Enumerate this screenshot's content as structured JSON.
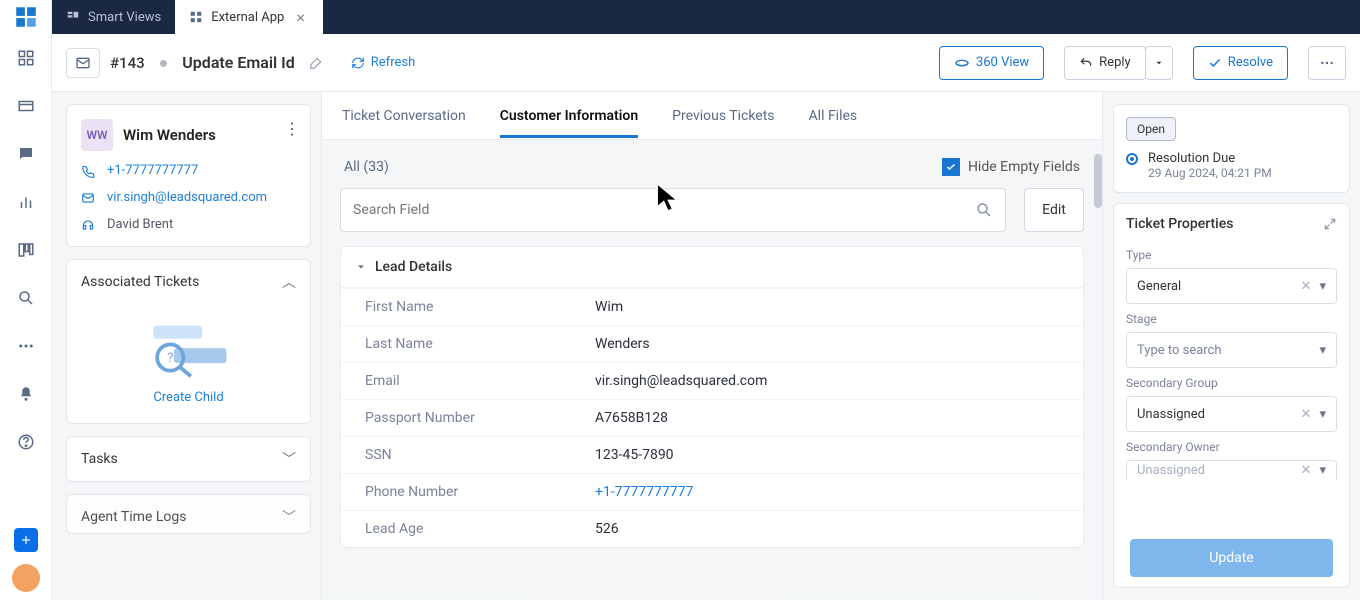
{
  "tabs": {
    "smart_views": "Smart Views",
    "external_app": "External App"
  },
  "ticket": {
    "id": "#143",
    "title": "Update Email Id",
    "refresh": "Refresh"
  },
  "actions": {
    "view360": "360 View",
    "reply": "Reply",
    "resolve": "Resolve"
  },
  "contact": {
    "initials": "WW",
    "name": "Wim Wenders",
    "phone": "+1-7777777777",
    "email": "vir.singh@leadsquared.com",
    "agent": "David Brent"
  },
  "assoc": {
    "title": "Associated Tickets",
    "create_child": "Create Child"
  },
  "left_collapsibles": {
    "tasks": "Tasks",
    "agent_logs": "Agent Time Logs"
  },
  "ptabs": {
    "conversation": "Ticket Conversation",
    "customer_info": "Customer Information",
    "previous": "Previous Tickets",
    "files": "All Files"
  },
  "filters": {
    "all": "All (33)",
    "hide_empty": "Hide Empty Fields",
    "search_placeholder": "Search Field",
    "edit": "Edit"
  },
  "section_title": "Lead Details",
  "lead": {
    "first_name_label": "First Name",
    "first_name": "Wim",
    "last_name_label": "Last Name",
    "last_name": "Wenders",
    "email_label": "Email",
    "email": "vir.singh@leadsquared.com",
    "passport_label": "Passport Number",
    "passport": "A7658B128",
    "ssn_label": "SSN",
    "ssn": "123-45-7890",
    "phone_label": "Phone Number",
    "phone": "+1-7777777777",
    "age_label": "Lead Age",
    "age": "526"
  },
  "right": {
    "open": "Open",
    "res_due": "Resolution Due",
    "res_time": "29 Aug 2024, 04:21 PM",
    "props_title": "Ticket Properties",
    "type_label": "Type",
    "type_value": "General",
    "stage_label": "Stage",
    "stage_placeholder": "Type to search",
    "sec_group_label": "Secondary Group",
    "sec_group_value": "Unassigned",
    "sec_owner_label": "Secondary Owner",
    "sec_owner_value": "Unassigned",
    "update": "Update"
  }
}
